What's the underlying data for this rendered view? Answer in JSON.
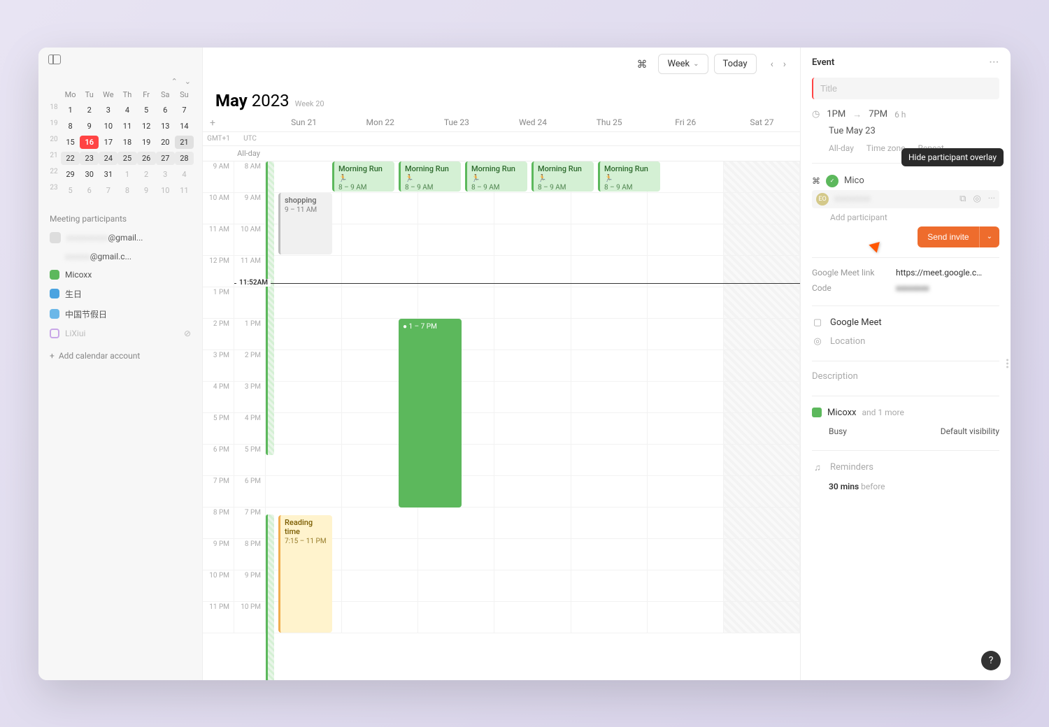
{
  "header": {
    "month": "May",
    "year": "2023",
    "week_label": "Week 20",
    "view_label": "Week",
    "today_label": "Today"
  },
  "mini_cal": {
    "days": [
      "Mo",
      "Tu",
      "We",
      "Th",
      "Fr",
      "Sa",
      "Su"
    ],
    "rows": [
      {
        "wk": "18",
        "d": [
          "1",
          "2",
          "3",
          "4",
          "5",
          "6",
          "7"
        ]
      },
      {
        "wk": "19",
        "d": [
          "8",
          "9",
          "10",
          "11",
          "12",
          "13",
          "14"
        ]
      },
      {
        "wk": "20",
        "d": [
          "15",
          "16",
          "17",
          "18",
          "19",
          "20",
          "21"
        ]
      },
      {
        "wk": "21",
        "d": [
          "22",
          "23",
          "24",
          "25",
          "26",
          "27",
          "28"
        ]
      },
      {
        "wk": "22",
        "d": [
          "29",
          "30",
          "31",
          "1",
          "2",
          "3",
          "4"
        ]
      },
      {
        "wk": "23",
        "d": [
          "5",
          "6",
          "7",
          "8",
          "9",
          "10",
          "11"
        ]
      }
    ],
    "today": "16",
    "selected": "21"
  },
  "sidebar": {
    "participants_label": "Meeting participants",
    "participants": [
      {
        "email": "@gmail..."
      },
      {
        "email": "@gmail.c..."
      }
    ],
    "calendars": [
      {
        "name": "Micoxx",
        "color": "#5cb85c",
        "on": true
      },
      {
        "name": "生日",
        "color": "#4aa3e0",
        "on": true
      },
      {
        "name": "中国节假日",
        "color": "#6bb7e8",
        "on": true
      },
      {
        "name": "LiXiui",
        "color": "#c9a7e8",
        "on": false
      }
    ],
    "add_account": "Add calendar account"
  },
  "timezones": {
    "left": "GMT+1",
    "right": "UTC"
  },
  "allday_label": "All-day",
  "days": [
    "Sun 21",
    "Mon 22",
    "Tue 23",
    "Wed 24",
    "Thu 25",
    "Fri 26",
    "Sat 27"
  ],
  "hours_left": [
    "9 AM",
    "10 AM",
    "11 AM",
    "12 PM",
    "1 PM",
    "2 PM",
    "3 PM",
    "4 PM",
    "5 PM",
    "6 PM",
    "7 PM",
    "8 PM",
    "9 PM",
    "10 PM",
    "11 PM"
  ],
  "hours_right": [
    "8 AM",
    "9 AM",
    "10 AM",
    "11 AM",
    "11:52AM",
    "1 PM",
    "2 PM",
    "3 PM",
    "4 PM",
    "5 PM",
    "6 PM",
    "7 PM",
    "8 PM",
    "9 PM",
    "10 PM"
  ],
  "now_time": "11:52AM",
  "events": {
    "morning_run": {
      "title": "Morning Run",
      "time": "8 – 9 AM",
      "emoji": "🏃"
    },
    "shopping": {
      "title": "shopping",
      "time": "9 – 11 AM"
    },
    "new_event": {
      "time": "1 – 7 PM"
    },
    "reading": {
      "title": "Reading time",
      "time": "7:15 – 11 PM"
    }
  },
  "detail": {
    "header": "Event",
    "title_placeholder": "Title",
    "start": "1PM",
    "end": "7PM",
    "duration": "6 h",
    "date": "Tue May 23",
    "options": [
      "All-day",
      "Time zone",
      "Repeat"
    ],
    "participants": [
      {
        "name": "Mico",
        "badge_color": "#5cb85c",
        "cmd": true
      },
      {
        "name": "EO",
        "initials": "EO",
        "badge_color": "#d4c98a"
      }
    ],
    "tooltip": "Hide participant overlay",
    "add_participant": "Add participant",
    "send_label": "Send invite",
    "meet_label": "Google Meet link",
    "meet_url": "https://meet.google.c…",
    "code_label": "Code",
    "google_meet": "Google Meet",
    "location": "Location",
    "description": "Description",
    "cal_name": "Micoxx",
    "cal_more": "and 1 more",
    "busy": "Busy",
    "visibility": "Default visibility",
    "reminders": "Reminders",
    "rem_val": "30 mins",
    "rem_sfx": "before"
  }
}
